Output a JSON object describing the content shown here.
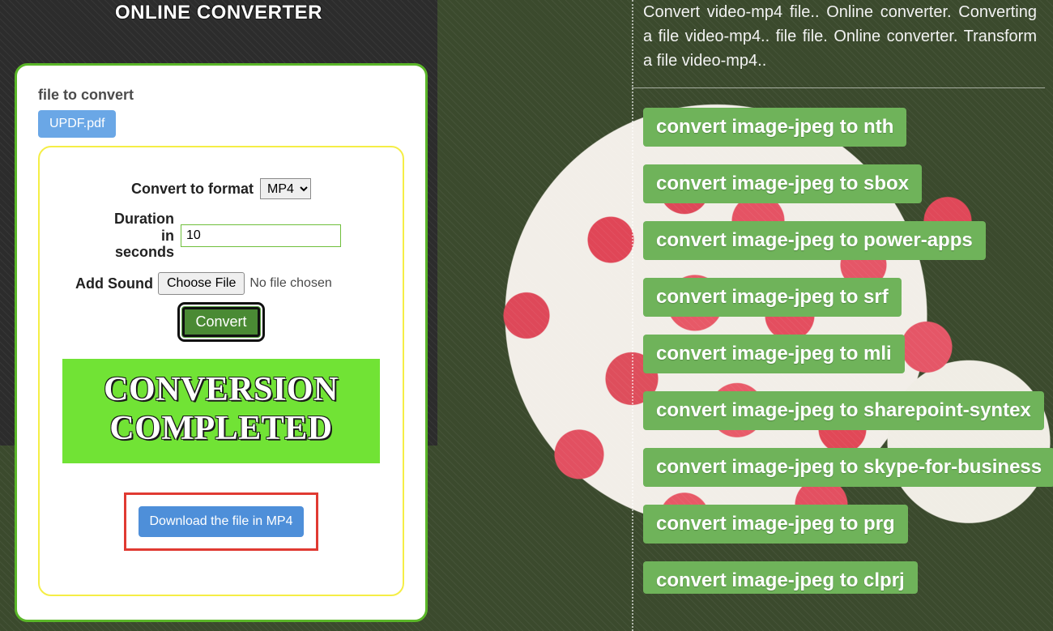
{
  "title": "ONLINE CONVERTER",
  "left": {
    "file_to_convert_label": "file to convert",
    "file_name": "UPDF.pdf",
    "convert_to_format_label": "Convert to format",
    "format_selected": "MP4",
    "duration_label": "Duration in seconds",
    "duration_value": "10",
    "add_sound_label": "Add Sound",
    "choose_file_button": "Choose File",
    "no_file_text": "No file chosen",
    "convert_button": "Convert",
    "completed_text": "CONVERSION COMPLETED",
    "download_button": "Download the file in MP4"
  },
  "right": {
    "description": "Convert video-mp4 file.. Online converter. Converting a file video-mp4.. file file. Online converter. Transform a file video-mp4..",
    "links": [
      "convert image-jpeg to nth",
      "convert image-jpeg to sbox",
      "convert image-jpeg to power-apps",
      "convert image-jpeg to srf",
      "convert image-jpeg to mli",
      "convert image-jpeg to sharepoint-syntex",
      "convert image-jpeg to skype-for-business",
      "convert image-jpeg to prg",
      "convert image-jpeg to clprj"
    ]
  }
}
